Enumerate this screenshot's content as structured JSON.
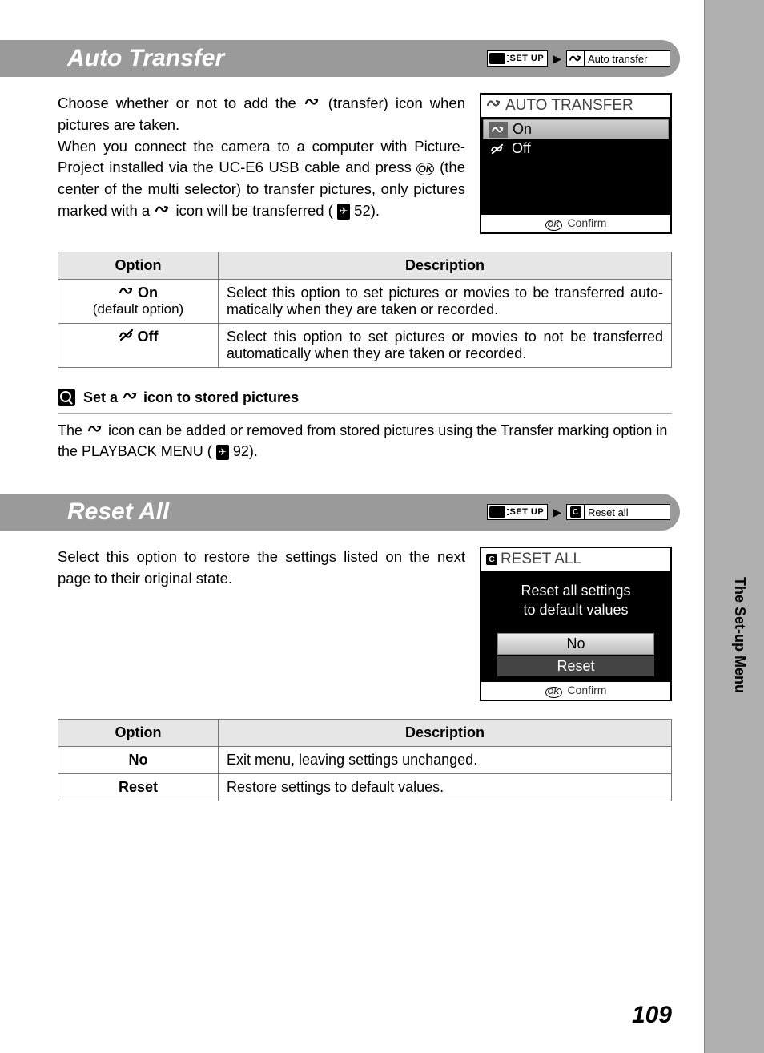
{
  "side_label": "The Set-up Menu",
  "page_number": "109",
  "breadcrumb": {
    "setup": "SET UP",
    "arrow": "▶"
  },
  "section_auto_transfer": {
    "title": "Auto Transfer",
    "bc_item": "Auto transfer",
    "para_a1": "Choose whether or not to add the ",
    "para_a2": " (transfer) icon when pictures are taken.",
    "para_b1": "When you connect the camera to a computer with Picture­Project installed via the UC-E6 USB cable and press ",
    "para_b2": " (the center of the multi selector) to transfer pictures, only pic­tures marked with a ",
    "para_b3": " icon will be transferred (",
    "para_b4": " 52).",
    "lcd_title": "AUTO TRANSFER",
    "lcd_on": "On",
    "lcd_off": "Off",
    "lcd_confirm": "Confirm",
    "table": {
      "h_option": "Option",
      "h_desc": "Description",
      "row1_opt": "On",
      "row1_sub": "(default option)",
      "row1_desc": "Select this option to set pictures or movies to be transferred auto­matically when they are taken or recorded.",
      "row2_opt": "Off",
      "row2_desc": "Select this option to set pictures or movies to not be transferred automatically when they are taken or recorded."
    },
    "note_head_1": "Set a ",
    "note_head_2": " icon to stored pictures",
    "note_body_1": "The ",
    "note_body_2": " icon can be added or removed from stored pictures using the Transfer marking option in the PLAYBACK MENU (",
    "note_body_3": " 92)."
  },
  "section_reset_all": {
    "title": "Reset All",
    "bc_item": "Reset all",
    "bc_icon_letter": "C",
    "para": "Select this option to restore the settings listed on the next page to their original state.",
    "lcd_title": "RESET ALL",
    "lcd_msg_l1": "Reset all settings",
    "lcd_msg_l2": "to default values",
    "lcd_no": "No",
    "lcd_reset": "Reset",
    "lcd_confirm": "Confirm",
    "table": {
      "h_option": "Option",
      "h_desc": "Description",
      "row1_opt": "No",
      "row1_desc": "Exit menu, leaving settings unchanged.",
      "row2_opt": "Reset",
      "row2_desc": "Restore settings to default values."
    }
  }
}
